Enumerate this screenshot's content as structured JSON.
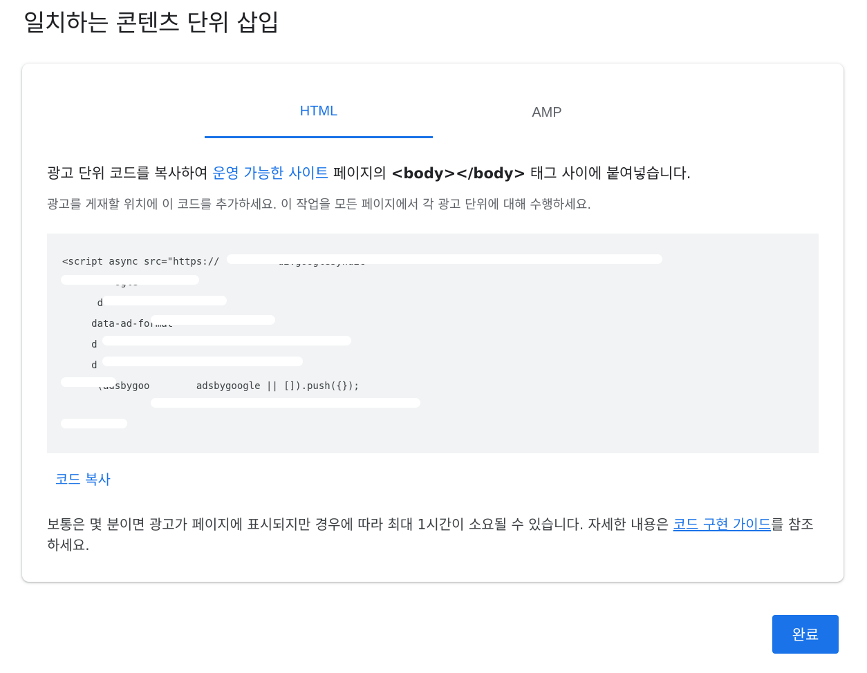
{
  "page": {
    "title": "일치하는 콘텐츠 단위 삽입"
  },
  "tabs": [
    {
      "label": "HTML",
      "active": true
    },
    {
      "label": "AMP",
      "active": false
    }
  ],
  "instructions": {
    "prefix": "광고 단위 코드를 복사하여 ",
    "link_text": "운영 가능한 사이트",
    "middle": " 페이지의 ",
    "code_tag": "<body></body>",
    "suffix": " 태그 사이에 붙여넣습니다."
  },
  "sub_instructions": "광고를 게재할 위치에 이 코드를 추가하세요. 이 작업을 모든 페이지에서 각 광고 단위에 대해 수행하세요.",
  "code_lines": [
    "<script async src=\"https://          d2.googlesyndic",
    "         ogle\"",
    "      d                 \"",
    "     data-ad-format",
    "     d              \"",
    "     d                          \"",
    "",
    "      (adsbygoo        adsbygoogle || []).push({});",
    ""
  ],
  "copy_link": "코드 복사",
  "footnote": {
    "text": "보통은 몇 분이면 광고가 페이지에 표시되지만 경우에 따라 최대 1시간이 소요될 수 있습니다. 자세한 내용은 ",
    "link_text": "코드 구현 가이드",
    "suffix": "를 참조하세요."
  },
  "done_button": "완료",
  "colors": {
    "accent": "#1a73e8",
    "code_bg": "#f1f3f4"
  }
}
